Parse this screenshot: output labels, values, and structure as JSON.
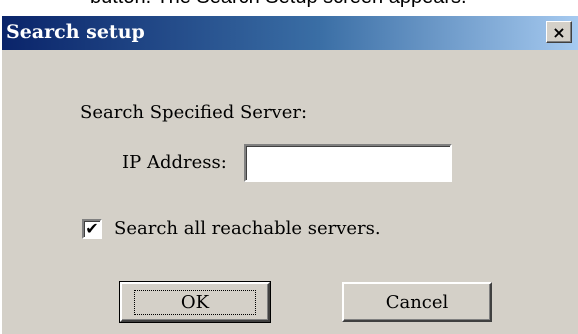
{
  "window": {
    "title": "Search setup",
    "close_glyph": "×",
    "cropped_caption": "button. The Search Setup screen appears."
  },
  "form": {
    "section_label": "Search Specified Server:",
    "ip_label": "IP Address:",
    "ip_value": "",
    "checkbox_label": "Search all reachable servers.",
    "checkbox_checked": true,
    "checkbox_glyph": "✔"
  },
  "buttons": {
    "ok_label": "OK",
    "cancel_label": "Cancel"
  },
  "colors": {
    "dialog_bg": "#d4d0c8",
    "titlebar_start": "#0a246a",
    "titlebar_end": "#a6caf0"
  }
}
